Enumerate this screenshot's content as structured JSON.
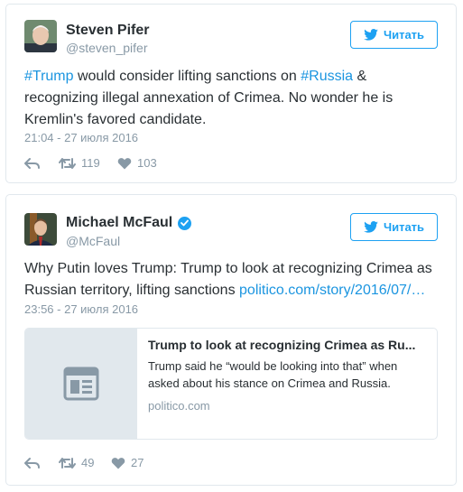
{
  "follow_label": "Читать",
  "colors": {
    "accent": "#1da1f2",
    "link": "#1b95e0",
    "muted": "#8899a6",
    "border": "#e1e8ed"
  },
  "tweets": [
    {
      "name": "Steven Pifer",
      "handle": "@steven_pifer",
      "verified": false,
      "text": {
        "hashtag1": "#Trump",
        "part1": " would consider lifting sanctions on ",
        "hashtag2": "#Russia",
        "part2": " & recognizing illegal annexation of Crimea. No wonder he is Kremlin's favored candidate."
      },
      "timestamp": "21:04 - 27 июля 2016",
      "retweets": "119",
      "likes": "103"
    },
    {
      "name": "Michael McFaul",
      "handle": "@McFaul",
      "verified": true,
      "text": {
        "part1": "Why Putin loves Trump: Trump to look at recognizing Crimea as Russian territory, lifting sanctions ",
        "link": "politico.com/story/2016/07/…"
      },
      "timestamp": "23:56 - 27 июля 2016",
      "card": {
        "title": "Trump to look at recognizing Crimea as Ru...",
        "description": "Trump said he “would be looking into that” when asked about his stance on Crimea and Russia.",
        "domain": "politico.com",
        "icon": "article-icon"
      },
      "retweets": "49",
      "likes": "27"
    }
  ],
  "icons": {
    "reply": "reply-icon",
    "retweet": "retweet-icon",
    "like": "heart-icon",
    "bird": "twitter-bird-icon",
    "verified": "verified-badge-icon"
  }
}
